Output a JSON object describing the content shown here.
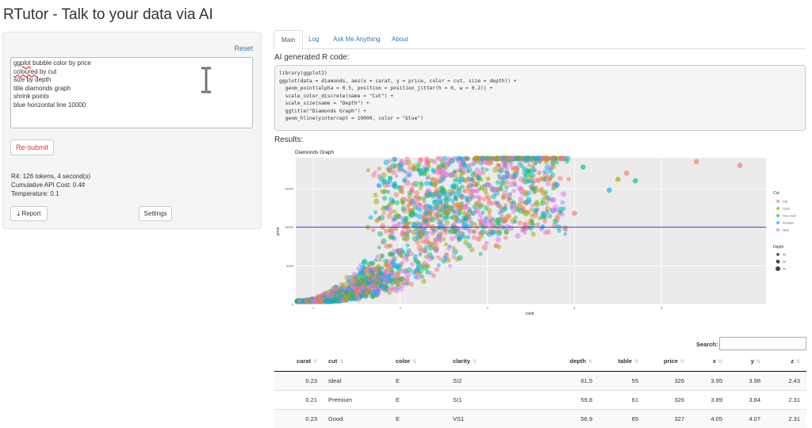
{
  "app": {
    "title": "RTutor - Talk to your data via AI"
  },
  "sidebar": {
    "reset_label": "Reset",
    "prompt_lines": [
      {
        "pre": "",
        "spell": "ggplot",
        "post": " bubble color by price"
      },
      {
        "pre": "",
        "spell": "coloured",
        "post": " by cut"
      },
      {
        "pre": "size by depth",
        "spell": "",
        "post": ""
      },
      {
        "pre": "title diamonds graph",
        "spell": "",
        "post": ""
      },
      {
        "pre": "shrink points",
        "spell": "",
        "post": ""
      },
      {
        "pre": "blue horizontal line 10000",
        "spell": "",
        "post": ""
      }
    ],
    "resubmit_label": "Re-submit",
    "stats": [
      "R4: 126 tokens, 4 second(s)",
      "Cumulative API Cost: 0.4¢",
      "Temperature: 0.1"
    ],
    "report_label": "Report",
    "settings_label": "Settings"
  },
  "tabs": [
    "Main",
    "Log",
    "Ask Me Anything",
    "About"
  ],
  "active_tab": "Main",
  "code_heading": "AI generated R code:",
  "code_lines": [
    "library(ggplot2)",
    "ggplot(data = diamonds, aes(x = carat, y = price, color = cut, size = depth)) +",
    "  geom_point(alpha = 0.5, position = position_jitter(h = 0, w = 0.2)) +",
    "  scale_color_discrete(name = \"Cut\") +",
    "  scale_size(name = \"Depth\") +",
    "  ggtitle(\"Diamonds Graph\") +",
    "  geom_hline(yintercept = 10000, color = \"blue\")"
  ],
  "results_heading": "Results:",
  "colors": {
    "link": "#337ab7",
    "hline": "#3b3bd6",
    "cut": [
      "#f8766d",
      "#a3a500",
      "#00bf7d",
      "#00b0f6",
      "#e76bf3"
    ]
  },
  "chart_data": {
    "type": "scatter",
    "title": "Diamonds Graph",
    "xlabel": "carat",
    "ylabel": "price",
    "xlim": [
      0,
      5.4
    ],
    "ylim": [
      0,
      19000
    ],
    "x_ticks": [
      "1",
      "2",
      "3",
      "4",
      "5"
    ],
    "x_tick_values": [
      0.2,
      1.2,
      2.2,
      3.2,
      4.2
    ],
    "y_ticks": [
      "0",
      "5000",
      "10000",
      "15000"
    ],
    "y_tick_values": [
      0,
      5000,
      10000,
      15000
    ],
    "hline": 10000,
    "legend": {
      "color_title": "Cut",
      "color_items": [
        "Fair",
        "Good",
        "Very Good",
        "Premium",
        "Ideal"
      ],
      "size_title": "Depth",
      "size_items": [
        "50",
        "60",
        "70"
      ]
    },
    "outliers": [
      {
        "x": 4.6,
        "y": 18500,
        "cut": 0
      },
      {
        "x": 5.1,
        "y": 18000,
        "cut": 0
      },
      {
        "x": 3.8,
        "y": 17000,
        "cut": 0
      },
      {
        "x": 3.9,
        "y": 16000,
        "cut": 2
      },
      {
        "x": 3.6,
        "y": 14800,
        "cut": 3
      },
      {
        "x": 3.0,
        "y": 15500,
        "cut": 3
      },
      {
        "x": 2.6,
        "y": 12500,
        "cut": 0
      },
      {
        "x": 3.2,
        "y": 11800,
        "cut": 0
      },
      {
        "x": 2.4,
        "y": 10800,
        "cut": 0
      },
      {
        "x": 2.1,
        "y": 8500,
        "cut": 0
      },
      {
        "x": 2.3,
        "y": 7600,
        "cut": 0
      },
      {
        "x": 3.7,
        "y": 16200,
        "cut": 1
      },
      {
        "x": 3.3,
        "y": 17800,
        "cut": 2
      }
    ]
  },
  "table": {
    "search_label": "Search:",
    "columns": [
      "carat",
      "cut",
      "color",
      "clarity",
      "depth",
      "table",
      "price",
      "x",
      "y",
      "z"
    ],
    "rows": [
      [
        "0.23",
        "Ideal",
        "E",
        "SI2",
        "61.5",
        "55",
        "326",
        "3.95",
        "3.98",
        "2.43"
      ],
      [
        "0.21",
        "Premium",
        "E",
        "SI1",
        "59.8",
        "61",
        "326",
        "3.89",
        "3.84",
        "2.31"
      ],
      [
        "0.23",
        "Good",
        "E",
        "VS1",
        "56.9",
        "65",
        "327",
        "4.05",
        "4.07",
        "2.31"
      ]
    ]
  }
}
